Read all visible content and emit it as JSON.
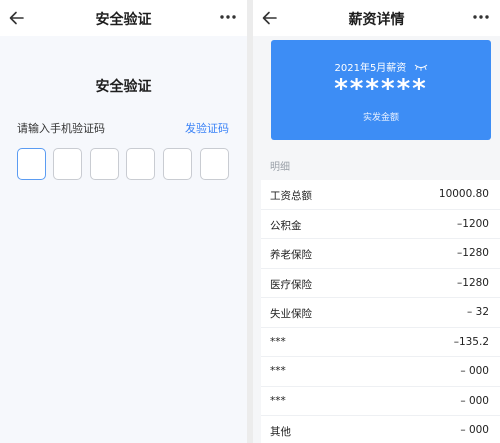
{
  "security": {
    "nav_title": "安全验证",
    "heading": "安全验证",
    "prompt": "请输入手机验证码",
    "send_code": "发验证码",
    "code_digits": [
      "",
      "",
      "",
      "",
      "",
      ""
    ]
  },
  "salary": {
    "nav_title": "薪资详情",
    "period": "2021年5月薪资",
    "masked_amount": "******",
    "amount_caption": "实发金额",
    "detail_header": "明细",
    "items": [
      {
        "label": "工资总额",
        "value": "10000.80"
      },
      {
        "label": "公积金",
        "value": "–1200"
      },
      {
        "label": "养老保险",
        "value": "–1280"
      },
      {
        "label": "医疗保险",
        "value": "–1280"
      },
      {
        "label": "失业保险",
        "value": "– 32"
      },
      {
        "label": "***",
        "value": "–135.2"
      },
      {
        "label": "***",
        "value": "– 000"
      },
      {
        "label": "***",
        "value": "– 000"
      },
      {
        "label": "其他",
        "value": "– 000"
      }
    ]
  },
  "icons": {
    "back": "arrow-left-icon",
    "more": "more-dots-icon",
    "visibility": "eye-closed-icon"
  },
  "colors": {
    "accent": "#3d8df5",
    "link": "#3a82f6",
    "active_border": "#5b9cf2"
  }
}
